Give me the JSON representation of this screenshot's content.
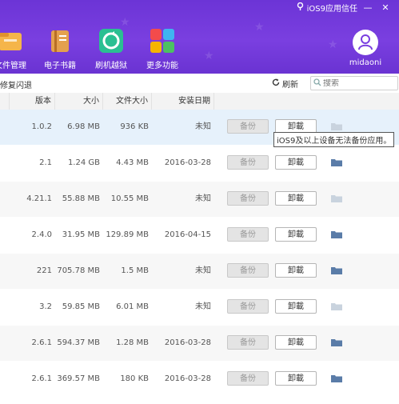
{
  "topbar": {
    "ios9_trust_label": "iOS9应用信任",
    "min_glyph": "—",
    "close_glyph": "✕"
  },
  "nav": [
    {
      "label": "文件管理",
      "icon": "folder-manager-icon",
      "color": "#f2a33a"
    },
    {
      "label": "电子书籍",
      "icon": "ebook-icon",
      "color": "#d58a3c"
    },
    {
      "label": "刷机越狱",
      "icon": "flash-jailbreak-icon",
      "color": "#25b28a"
    },
    {
      "label": "更多功能",
      "icon": "more-features-icon",
      "color": "#f0a020"
    }
  ],
  "user": {
    "name": "midaoni"
  },
  "toolbar": {
    "breadcrumb": "修复闪退",
    "refresh_label": "刷新",
    "search_placeholder": "搜索"
  },
  "table": {
    "headers": {
      "version": "版本",
      "size": "大小",
      "file_size": "文件大小",
      "install_date": "安装日期"
    },
    "backup_label": "备份",
    "uninstall_label": "卸載",
    "rows": [
      {
        "version": "1.0.2",
        "size": "6.98 MB",
        "file_size": "936 KB",
        "date": "未知",
        "highlight": true,
        "folder": "light"
      },
      {
        "version": "2.1",
        "size": "1.24 GB",
        "file_size": "4.43 MB",
        "date": "2016-03-28",
        "highlight": false,
        "folder": "dark"
      },
      {
        "version": "4.21.1",
        "size": "55.88 MB",
        "file_size": "10.55 MB",
        "date": "未知",
        "highlight": false,
        "folder": "light"
      },
      {
        "version": "2.4.0",
        "size": "31.95 MB",
        "file_size": "129.89 MB",
        "date": "2016-04-15",
        "highlight": false,
        "folder": "dark"
      },
      {
        "version": "221",
        "size": "705.78 MB",
        "file_size": "1.5 MB",
        "date": "未知",
        "highlight": false,
        "folder": "dark"
      },
      {
        "version": "3.2",
        "size": "59.85 MB",
        "file_size": "6.01 MB",
        "date": "未知",
        "highlight": false,
        "folder": "light"
      },
      {
        "version": "2.6.1",
        "size": "594.37 MB",
        "file_size": "1.28 MB",
        "date": "2016-03-28",
        "highlight": false,
        "folder": "dark"
      },
      {
        "version": "2.6.1",
        "size": "369.57 MB",
        "file_size": "180 KB",
        "date": "2016-03-28",
        "highlight": false,
        "folder": "dark"
      }
    ]
  },
  "tooltip": "iOS9及以上设备无法备份应用。",
  "colors": {
    "header_purple": "#7a3fe0",
    "row_highlight": "#e6f1fb",
    "row_alt": "#f7f7f7",
    "folder_dark": "#5a7ca8",
    "folder_light": "#c9d3de"
  }
}
